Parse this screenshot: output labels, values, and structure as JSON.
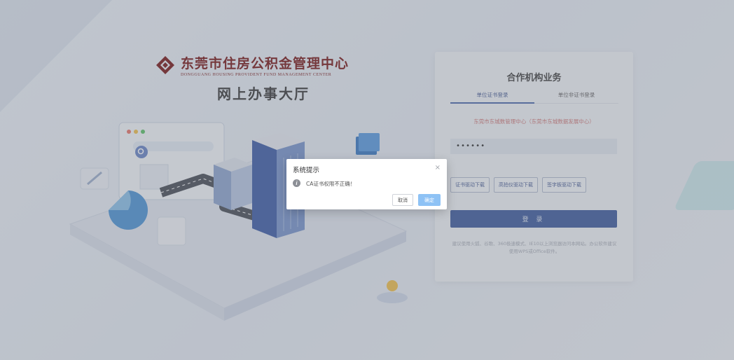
{
  "brand": {
    "name_cn": "东莞市住房公积金管理中心",
    "name_en": "DONGGUANG HOUSING PROVIDENT FUND MANAGEMENT CENTER",
    "hall_title": "网上办事大厅",
    "logo_color": "#7a1a1a"
  },
  "login_panel": {
    "title": "合作机构业务",
    "tabs": [
      {
        "label": "单位证书登录",
        "active": true
      },
      {
        "label": "单位非证书登录",
        "active": false
      }
    ],
    "org_name": "东莞市东城数管理中心（东莞市东城数据发展中心）",
    "password_value": "••••••",
    "download_buttons": [
      {
        "label": "证书驱动下载"
      },
      {
        "label": "高拍仪驱动下载"
      },
      {
        "label": "签字板驱动下载"
      }
    ],
    "login_button": "登 录",
    "tip": "建议使用火狐、谷歌、360极速模式、IE10以上浏览器访问本网站。办公软件建议使用WPS或Office软件。",
    "accent_color": "#3f5c9e"
  },
  "modal": {
    "title": "系统提示",
    "close_symbol": "×",
    "icon": "i",
    "message": "CA证书权限不正确！",
    "cancel_label": "取消",
    "ok_label": "确定"
  }
}
